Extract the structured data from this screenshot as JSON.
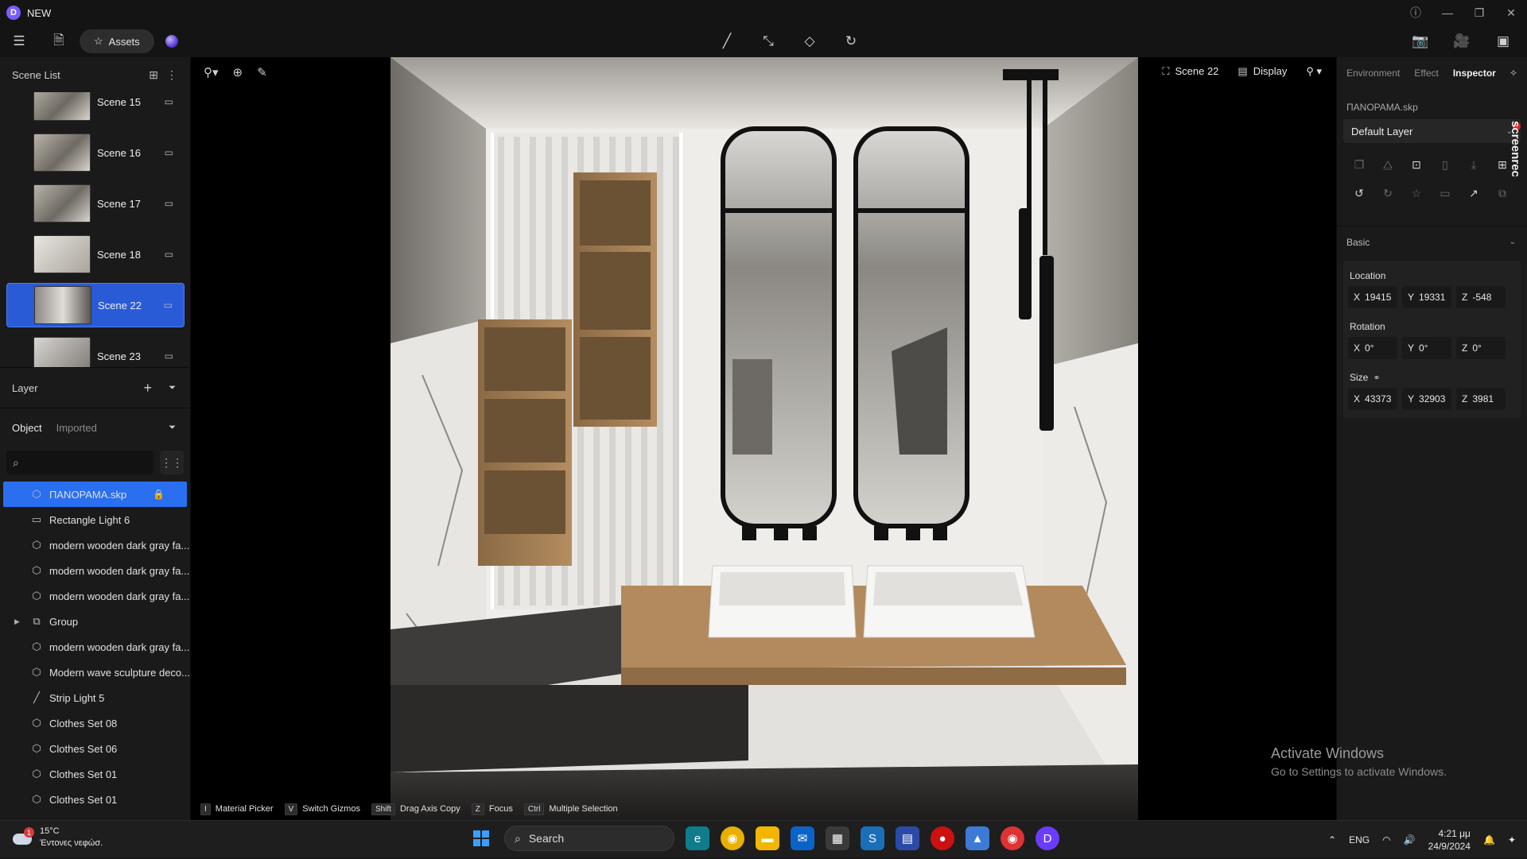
{
  "app": {
    "title": "NEW",
    "logo_glyph": "D"
  },
  "toolbar": {
    "assets_label": "Assets"
  },
  "scene_list": {
    "title": "Scene List",
    "items": [
      {
        "label": "Scene 15",
        "active": false
      },
      {
        "label": "Scene 16",
        "active": false
      },
      {
        "label": "Scene 17",
        "active": false
      },
      {
        "label": "Scene 18",
        "active": false
      },
      {
        "label": "Scene 22",
        "active": true
      },
      {
        "label": "Scene 23",
        "active": false
      }
    ]
  },
  "layer_panel": {
    "title": "Layer"
  },
  "object_panel": {
    "tabs": [
      "Object",
      "Imported"
    ],
    "search_placeholder": "",
    "items": [
      {
        "label": "ΠΑΝΟΡΑΜΑ.skp",
        "icon": "cube-outline-icon",
        "selected": true
      },
      {
        "label": "Rectangle Light 6",
        "icon": "rect-light-icon"
      },
      {
        "label": "modern wooden dark gray fa...",
        "icon": "cube-icon"
      },
      {
        "label": "modern wooden dark gray fa...",
        "icon": "cube-icon"
      },
      {
        "label": "modern wooden dark gray fa...",
        "icon": "cube-icon"
      },
      {
        "label": "Group",
        "icon": "group-icon",
        "expandable": true
      },
      {
        "label": "modern wooden dark gray fa...",
        "icon": "cube-icon"
      },
      {
        "label": "Modern wave sculpture deco...",
        "icon": "cube-icon"
      },
      {
        "label": "Strip Light 5",
        "icon": "strip-light-icon"
      },
      {
        "label": "Clothes Set 08",
        "icon": "cube-icon"
      },
      {
        "label": "Clothes Set 06",
        "icon": "cube-icon"
      },
      {
        "label": "Clothes Set 01",
        "icon": "cube-icon"
      },
      {
        "label": "Clothes Set 01",
        "icon": "cube-icon"
      }
    ]
  },
  "viewport": {
    "scene_label": "Scene 22",
    "display_label": "Display",
    "hints": [
      {
        "key": "I",
        "label": "Material Picker"
      },
      {
        "key": "V",
        "label": "Switch Gizmos"
      },
      {
        "key": "Shift",
        "label": "Drag Axis Copy"
      },
      {
        "key": "Z",
        "label": "Focus"
      },
      {
        "key": "Ctrl",
        "label": "Multiple Selection"
      }
    ]
  },
  "inspector": {
    "tabs": [
      "Environment",
      "Effect",
      "Inspector"
    ],
    "active_tab": "Inspector",
    "file_name": "ΠΑΝΟΡΑΜΑ.skp",
    "layer_value": "Default Layer",
    "screenrec_label": "screenrec",
    "basic_label": "Basic",
    "location": {
      "label": "Location",
      "x": "19415",
      "y": "19331",
      "z": "-548"
    },
    "rotation": {
      "label": "Rotation",
      "x": "0°",
      "y": "0°",
      "z": "0°"
    },
    "size": {
      "label": "Size",
      "x": "43373",
      "y": "32903",
      "z": "3981"
    }
  },
  "watermark": {
    "line1": "Activate Windows",
    "line2": "Go to Settings to activate Windows."
  },
  "taskbar": {
    "weather_temp": "15°C",
    "weather_desc": "Έντονες νεφώσ.",
    "weather_badge": "1",
    "search_label": "Search",
    "lang": "ENG",
    "time": "4:21 μμ",
    "date": "24/9/2024"
  },
  "colors": {
    "accent": "#2a6ff0",
    "active_scene": "#2a5bd7",
    "background": "#141414",
    "panel": "#1a1a1a"
  }
}
